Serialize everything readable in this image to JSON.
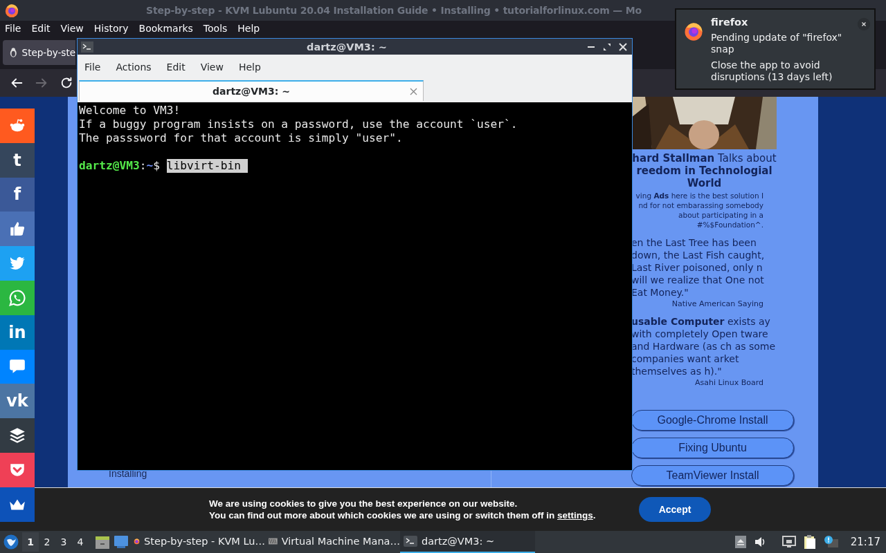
{
  "browser": {
    "title": "Step-by-step - KVM Lubuntu 20.04 Installation Guide • Installing • tutorialforlinux.com — Mo",
    "menu": [
      "File",
      "Edit",
      "View",
      "History",
      "Bookmarks",
      "Tools",
      "Help"
    ],
    "tab": {
      "label": "Step-by-ste",
      "selected": true
    },
    "nav": [
      {
        "kind": "back",
        "disabled": false
      },
      {
        "kind": "forward",
        "disabled": true
      },
      {
        "kind": "reload",
        "disabled": false
      }
    ]
  },
  "page": {
    "share_buttons": [
      {
        "kind": "alien",
        "color": "#ff5a1f"
      },
      {
        "kind": "glyph",
        "glyph": "t",
        "color": "#35465c"
      },
      {
        "kind": "glyph",
        "glyph": "f",
        "color": "#3b5998"
      },
      {
        "kind": "thumb",
        "color": "#4a70b5"
      },
      {
        "kind": "bird",
        "color": "#1da1f2"
      },
      {
        "kind": "chat-phone",
        "color": "#2bb741"
      },
      {
        "kind": "glyph",
        "glyph": "in",
        "color": "#0077b5"
      },
      {
        "kind": "chat",
        "color": "#0084ff"
      },
      {
        "kind": "glyph",
        "glyph": "vk",
        "color": "#4c75a3"
      },
      {
        "kind": "stack",
        "color": "#323b43"
      },
      {
        "kind": "pocket",
        "color": "#ef4056"
      },
      {
        "kind": "crown",
        "color": "#0d52b8"
      }
    ],
    "article_text": "Installing",
    "sidebar": {
      "picture": {
        "kind": "picture"
      },
      "caption": "**hard Stallman** Talks about **reedom in Technologial World**",
      "ad_note": "ving **Ads** here is the best solution I nd for not embarassing somebody about participating in a #%$Foundation^.",
      "quotes": [
        {
          "text": "en the Last Tree has been down, the Last Fish caught, Last River poisoned, only n will we realize that One not Eat Money.\"",
          "source": "Native American Saying"
        },
        {
          "text": "**usable Computer** exists ay with completely Open tware and Hardware (as ch as some companies want arket themselves as h).\"",
          "source": "Asahi Linux Board"
        }
      ],
      "buttons": [
        "Google-Chrome Install",
        "Fixing Ubuntu",
        "TeamViewer Install"
      ]
    }
  },
  "terminal": {
    "title": "dartz@VM3: ~",
    "menu": [
      "File",
      "Actions",
      "Edit",
      "View",
      "Help"
    ],
    "tab": {
      "label": "dartz@VM3: ~",
      "selected": true
    },
    "lines": [
      "Welcome to VM3!",
      "If a buggy program insists on a password, use the account `user`.",
      "The passsword for that account is simply \"user\"."
    ],
    "prompt": {
      "user": "dartz@VM3",
      "separator": ":",
      "path": "~",
      "symbol": "$",
      "command": "libvirt-bin",
      "selected": true
    }
  },
  "notification": {
    "app": "firefox",
    "summary": "Pending update of \"firefox\" snap",
    "body": "Close the app to avoid disruptions (13 days left)"
  },
  "cookie_banner": {
    "line_1": "We are using cookies to give you the best experience on our website.",
    "line_2_before": "You can find out more about which cookies we are using or switch them off in ",
    "link": "settings",
    "line_2_after": ".",
    "button": "Accept"
  },
  "taskbar": {
    "desktops": [
      {
        "label": "1",
        "selected": true
      },
      {
        "label": "2",
        "selected": false
      },
      {
        "label": "3",
        "selected": false
      },
      {
        "label": "4",
        "selected": false
      }
    ],
    "tasks": [
      {
        "kind": "browser",
        "label": "Step-by-step - KVM Lu…",
        "selected": false
      },
      {
        "kind": "vm",
        "label": "Virtual Machine Mana…",
        "selected": false
      },
      {
        "kind": "terminal",
        "label": "dartz@VM3: ~",
        "selected": true
      }
    ],
    "clock": "21:17"
  }
}
